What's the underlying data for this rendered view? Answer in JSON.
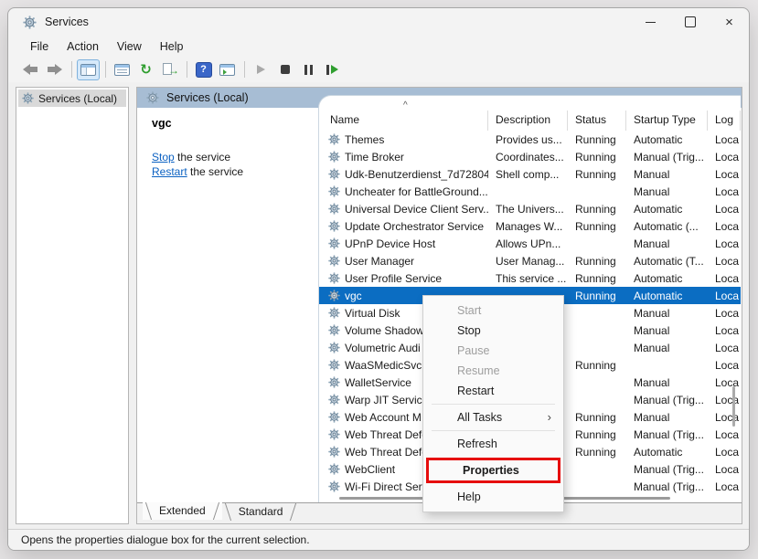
{
  "window": {
    "title": "Services"
  },
  "window_controls": [
    "minimize-button",
    "maximize-button",
    "close-button"
  ],
  "menu_bar": {
    "items": [
      "File",
      "Action",
      "View",
      "Help"
    ]
  },
  "toolbar": {
    "buttons": [
      "back",
      "forward",
      "show-console-tree",
      "properties",
      "refresh",
      "export-list",
      "help",
      "show-action-pane",
      "start-service",
      "stop-service",
      "pause-service",
      "restart-service"
    ]
  },
  "icons": {
    "close": "×",
    "refresh": "↻",
    "export_arrow": "→",
    "help": "?",
    "submenu_arrow": "›"
  },
  "tree": {
    "root": "Services (Local)"
  },
  "main": {
    "header": "Services (Local)",
    "service": {
      "name": "vgc",
      "links": [
        {
          "action": "Stop",
          "rest": " the service"
        },
        {
          "action": "Restart",
          "rest": " the service"
        }
      ]
    }
  },
  "table": {
    "columns": [
      "Name",
      "Description",
      "Status",
      "Startup Type",
      "Log"
    ],
    "sort_indicator": "^",
    "rows": [
      {
        "name": "Themes",
        "description": "Provides us...",
        "status": "Running",
        "startup": "Automatic",
        "log": "Loca",
        "selected": false
      },
      {
        "name": "Time Broker",
        "description": "Coordinates...",
        "status": "Running",
        "startup": "Manual (Trig...",
        "log": "Loca",
        "selected": false
      },
      {
        "name": "Udk-Benutzerdienst_7d72804",
        "description": "Shell comp...",
        "status": "Running",
        "startup": "Manual",
        "log": "Loca",
        "selected": false
      },
      {
        "name": "Uncheater for BattleGround...",
        "description": "",
        "status": "",
        "startup": "Manual",
        "log": "Loca",
        "selected": false
      },
      {
        "name": "Universal Device Client Serv...",
        "description": "The Univers...",
        "status": "Running",
        "startup": "Automatic",
        "log": "Loca",
        "selected": false
      },
      {
        "name": "Update Orchestrator Service",
        "description": "Manages W...",
        "status": "Running",
        "startup": "Automatic (...",
        "log": "Loca",
        "selected": false
      },
      {
        "name": "UPnP Device Host",
        "description": "Allows UPn...",
        "status": "",
        "startup": "Manual",
        "log": "Loca",
        "selected": false
      },
      {
        "name": "User Manager",
        "description": "User Manag...",
        "status": "Running",
        "startup": "Automatic (T...",
        "log": "Loca",
        "selected": false
      },
      {
        "name": "User Profile Service",
        "description": "This service ...",
        "status": "Running",
        "startup": "Automatic",
        "log": "Loca",
        "selected": false
      },
      {
        "name": "vgc",
        "description": "",
        "status": "Running",
        "startup": "Automatic",
        "log": "Loca",
        "selected": true
      },
      {
        "name": "Virtual Disk",
        "description": "",
        "status": "",
        "startup": "Manual",
        "log": "Loca",
        "selected": false
      },
      {
        "name": "Volume Shadow",
        "description": "",
        "status": "",
        "startup": "Manual",
        "log": "Loca",
        "selected": false
      },
      {
        "name": "Volumetric Audi",
        "description": "",
        "status": "",
        "startup": "Manual",
        "log": "Loca",
        "selected": false
      },
      {
        "name": "WaaSMedicSvc",
        "description": "",
        "status": "Running",
        "startup": "",
        "log": "Loca",
        "selected": false
      },
      {
        "name": "WalletService",
        "description": "",
        "status": "",
        "startup": "Manual",
        "log": "Loca",
        "selected": false
      },
      {
        "name": "Warp JIT Service",
        "description": "",
        "status": "",
        "startup": "Manual (Trig...",
        "log": "Loca",
        "selected": false
      },
      {
        "name": "Web Account M",
        "description": "",
        "status": "Running",
        "startup": "Manual",
        "log": "Loca",
        "selected": false
      },
      {
        "name": "Web Threat Defe",
        "description": "",
        "status": "Running",
        "startup": "Manual (Trig...",
        "log": "Loca",
        "selected": false
      },
      {
        "name": "Web Threat Defe",
        "description": "",
        "status": "Running",
        "startup": "Automatic",
        "log": "Loca",
        "selected": false
      },
      {
        "name": "WebClient",
        "description": "",
        "status": "",
        "startup": "Manual (Trig...",
        "log": "Loca",
        "selected": false
      },
      {
        "name": "Wi-Fi Direct Serv",
        "description": "",
        "status": "",
        "startup": "Manual (Trig...",
        "log": "Loca",
        "selected": false
      }
    ]
  },
  "context_menu": {
    "items": [
      {
        "label": "Start",
        "disabled": true
      },
      {
        "label": "Stop",
        "disabled": false
      },
      {
        "label": "Pause",
        "disabled": true
      },
      {
        "label": "Resume",
        "disabled": true
      },
      {
        "label": "Restart",
        "disabled": false
      },
      {
        "separator": true
      },
      {
        "label": "All Tasks",
        "disabled": false,
        "submenu": true
      },
      {
        "separator": true
      },
      {
        "label": "Refresh",
        "disabled": false
      },
      {
        "label": "Properties",
        "disabled": false,
        "bold": true,
        "highlighted": true
      },
      {
        "label": "Help",
        "disabled": false
      }
    ]
  },
  "tabs": {
    "items": [
      {
        "label": "Extended",
        "selected": true
      },
      {
        "label": "Standard",
        "selected": false
      }
    ]
  },
  "status_bar": {
    "text": "Opens the properties dialogue box for the current selection."
  },
  "colors": {
    "selection_blue": "#0b6dc2",
    "header_blue": "#a7bdd4",
    "highlight_red": "#e60d0d",
    "link_blue": "#0b61c2"
  }
}
